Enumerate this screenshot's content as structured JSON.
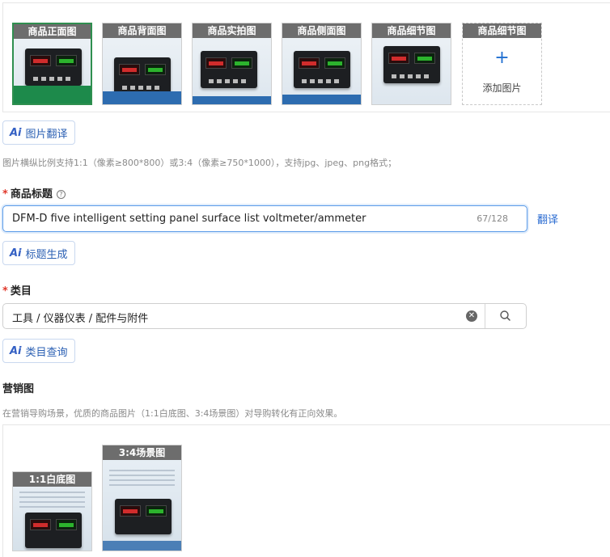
{
  "product_images": {
    "tiles": [
      {
        "caption": "商品正面图"
      },
      {
        "caption": "商品背面图"
      },
      {
        "caption": "商品实拍图"
      },
      {
        "caption": "商品侧面图"
      },
      {
        "caption": "商品细节图"
      }
    ],
    "add_tile": {
      "caption": "商品细节图",
      "label": "添加图片",
      "icon": "plus-icon"
    }
  },
  "ai_image_translate": {
    "logo": "Ai",
    "label": "图片翻译"
  },
  "image_hint": "图片横纵比例支持1:1（像素≥800*800）或3:4（像素≥750*1000），支持jpg、jpeg、png格式；",
  "title_field": {
    "required_mark": "*",
    "label": "商品标题",
    "help_icon": "question-circle-icon",
    "value": "DFM-D five intelligent setting panel surface list voltmeter/ammeter",
    "count": "67/128",
    "translate_link": "翻译"
  },
  "ai_title_generate": {
    "logo": "Ai",
    "label": "标题生成"
  },
  "category_field": {
    "required_mark": "*",
    "label": "类目",
    "value": "工具 / 仪器仪表 / 配件与附件",
    "clear_icon": "clear-circle-icon",
    "search_icon": "search-icon"
  },
  "ai_category_query": {
    "logo": "Ai",
    "label": "类目查询"
  },
  "marketing": {
    "label": "营销图",
    "hint": "在营销导购场景，优质的商品图片（1:1白底图、3:4场景图）对导购转化有正向效果。",
    "images": [
      {
        "caption": "1:1白底图"
      },
      {
        "caption": "3:4场景图"
      }
    ]
  },
  "colors": {
    "accent": "#2a6bd1",
    "required": "#e0382b",
    "caption_bg": "#6d6d6d",
    "selected_border": "#2f8f4f"
  }
}
